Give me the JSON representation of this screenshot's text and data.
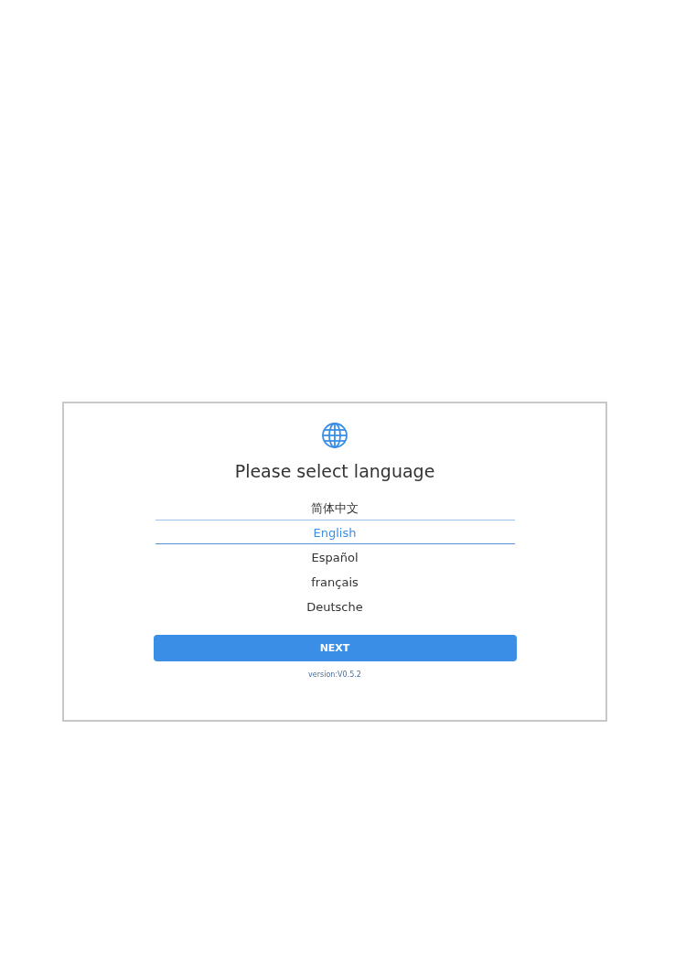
{
  "title": "Please select language",
  "languages": [
    {
      "label": "简体中文",
      "selected": false
    },
    {
      "label": "English",
      "selected": true
    },
    {
      "label": "Español",
      "selected": false
    },
    {
      "label": "français",
      "selected": false
    },
    {
      "label": "Deutsche",
      "selected": false
    }
  ],
  "next_button": "NEXT",
  "version": "version:V0.5.2"
}
